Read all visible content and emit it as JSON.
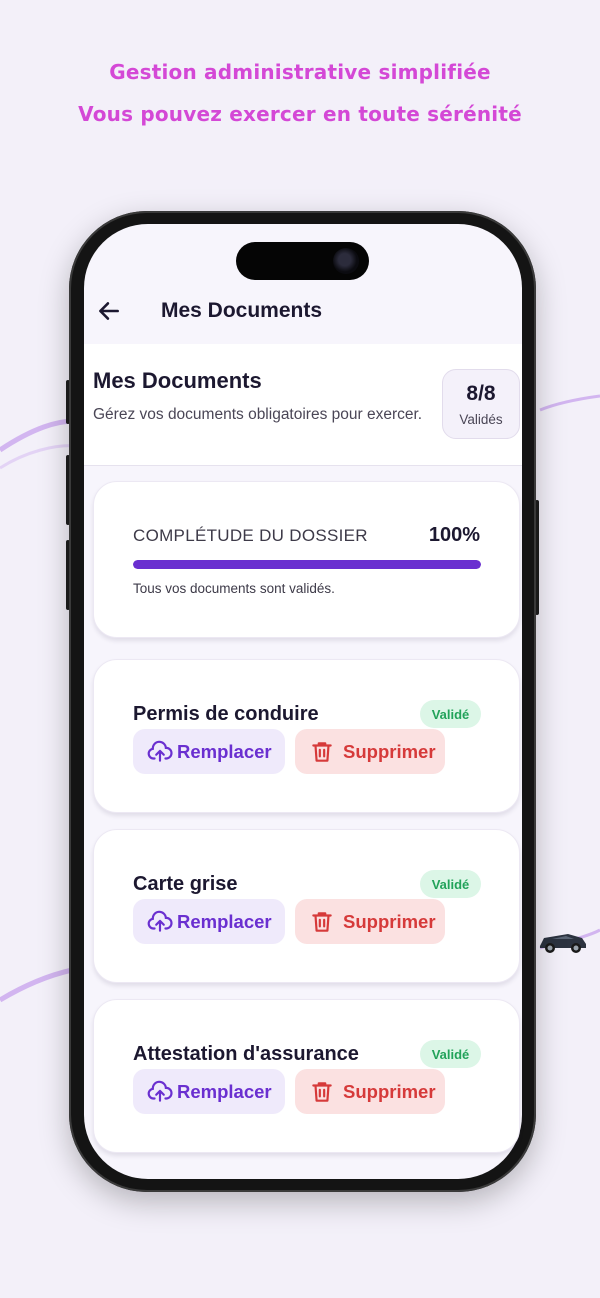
{
  "headline": {
    "line1": "Gestion administrative simplifiée",
    "line2": "Vous pouvez exercer en toute sérénité"
  },
  "colors": {
    "headline": "#d448d6",
    "accent": "#6a2fd0",
    "danger": "#d63a3a",
    "success": "#22a35a"
  },
  "nav": {
    "back_icon": "arrow-left-icon",
    "title": "Mes Documents"
  },
  "header": {
    "title": "Mes Documents",
    "subtitle": "Gérez vos documents obligatoires pour exercer.",
    "count_value": "8/8",
    "count_label": "Validés"
  },
  "progress": {
    "label": "COMPLÉTUDE DU DOSSIER",
    "value_text": "100%",
    "fraction": 1.0,
    "note": "Tous vos documents sont validés."
  },
  "documents": [
    {
      "title": "Permis de conduire",
      "status": "Validé",
      "replace_label": "Remplacer",
      "delete_label": "Supprimer"
    },
    {
      "title": "Carte grise",
      "status": "Validé",
      "replace_label": "Remplacer",
      "delete_label": "Supprimer"
    },
    {
      "title": "Attestation d'assurance",
      "status": "Validé",
      "replace_label": "Remplacer",
      "delete_label": "Supprimer"
    }
  ],
  "icons": {
    "replace": "cloud-upload-icon",
    "delete": "trash-icon"
  }
}
